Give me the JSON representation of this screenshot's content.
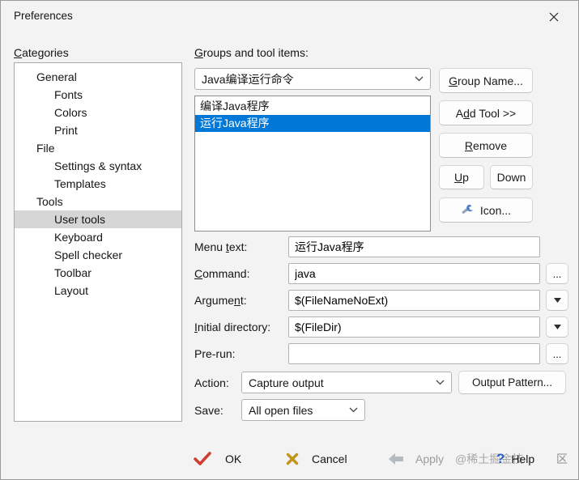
{
  "window": {
    "title": "Preferences"
  },
  "colors": {
    "selection_blue": "#0078d7",
    "tree_selection": "#d6d6d6"
  },
  "categories": {
    "label": {
      "pre": "",
      "key": "C",
      "post": "ategories"
    },
    "items": [
      {
        "label": "General"
      },
      {
        "label": "Fonts"
      },
      {
        "label": "Colors"
      },
      {
        "label": "Print"
      },
      {
        "label": "File"
      },
      {
        "label": "Settings & syntax"
      },
      {
        "label": "Templates"
      },
      {
        "label": "Tools"
      },
      {
        "label": "User tools"
      },
      {
        "label": "Keyboard"
      },
      {
        "label": "Spell checker"
      },
      {
        "label": "Toolbar"
      },
      {
        "label": "Layout"
      }
    ]
  },
  "groups": {
    "label": {
      "pre": "",
      "key": "G",
      "post": "roups and tool items:"
    },
    "selected_group": "Java编译运行命令",
    "tools": [
      {
        "label": "编译Java程序"
      },
      {
        "label": "运行Java程序"
      }
    ]
  },
  "buttons": {
    "group_name": {
      "pre": "",
      "key": "G",
      "post": "roup Name..."
    },
    "add_tool": {
      "pre": "A",
      "key": "d",
      "post": "d Tool >>"
    },
    "remove": {
      "pre": "",
      "key": "R",
      "post": "emove"
    },
    "up": {
      "pre": "",
      "key": "U",
      "post": "p"
    },
    "down": "Down",
    "icon": "Icon...",
    "output_pattern": "Output Pattern...",
    "browse": "..."
  },
  "fields": {
    "menu_text": {
      "label": {
        "pre": "Menu ",
        "key": "t",
        "post": "ext:"
      },
      "value": "运行Java程序"
    },
    "command": {
      "label": {
        "pre": "",
        "key": "C",
        "post": "ommand:"
      },
      "value": "java"
    },
    "argument": {
      "label": {
        "pre": "Argume",
        "key": "n",
        "post": "t:"
      },
      "value": "$(FileNameNoExt)"
    },
    "initial_directory": {
      "label": {
        "pre": "",
        "key": "I",
        "post": "nitial directory:"
      },
      "value": "$(FileDir)"
    },
    "pre_run": {
      "label": "Pre-run:",
      "value": ""
    },
    "action": {
      "label": "Action:",
      "value": "Capture output"
    },
    "save": {
      "label": "Save:",
      "value": "All open files"
    }
  },
  "footer": {
    "ok": "OK",
    "cancel": "Cancel",
    "apply": "Apply",
    "help": "Help",
    "watermark_left": "@稀土掘金技",
    "watermark_right": "区"
  }
}
